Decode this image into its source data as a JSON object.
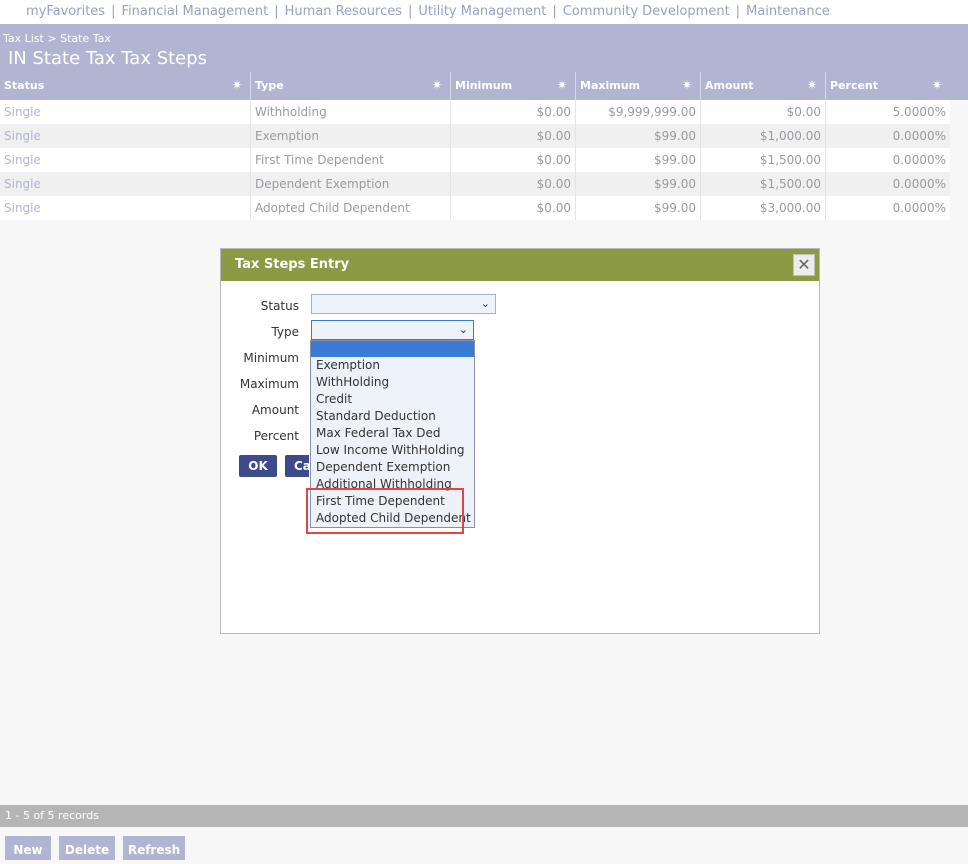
{
  "nav": {
    "items": [
      "myFavorites",
      "Financial Management",
      "Human Resources",
      "Utility Management",
      "Community Development",
      "Maintenance"
    ],
    "separator": "|"
  },
  "header": {
    "breadcrumb": [
      "Tax List",
      ">",
      "State Tax"
    ],
    "title": "IN State Tax Tax Steps"
  },
  "grid": {
    "columns": [
      "Status",
      "Type",
      "Minimum",
      "Maximum",
      "Amount",
      "Percent"
    ],
    "rows": [
      [
        "Single",
        "Withholding",
        "$0.00",
        "$9,999,999.00",
        "$0.00",
        "5.0000%"
      ],
      [
        "Single",
        "Exemption",
        "$0.00",
        "$99.00",
        "$1,000.00",
        "0.0000%"
      ],
      [
        "Single",
        "First Time Dependent",
        "$0.00",
        "$99.00",
        "$1,500.00",
        "0.0000%"
      ],
      [
        "Single",
        "Dependent Exemption",
        "$0.00",
        "$99.00",
        "$1,500.00",
        "0.0000%"
      ],
      [
        "Single",
        "Adopted Child Dependent",
        "$0.00",
        "$99.00",
        "$3,000.00",
        "0.0000%"
      ]
    ],
    "gear_icon": "gear-icon"
  },
  "dialog": {
    "title": "Tax Steps Entry",
    "close_icon": "close-icon",
    "labels": {
      "status": "Status",
      "type": "Type",
      "minimum": "Minimum",
      "maximum": "Maximum",
      "amount": "Amount",
      "percent": "Percent"
    },
    "status_value": "",
    "type_value": "",
    "ok_label": "OK",
    "cancel_label_visible": "Ca",
    "type_options": [
      "",
      "Exemption",
      "WithHolding",
      "Credit",
      "Standard Deduction",
      "Max Federal Tax Ded",
      "Low Income WithHolding",
      "Dependent Exemption",
      "Additional Withholding",
      "First Time Dependent",
      "Adopted Child Dependent"
    ]
  },
  "footer": {
    "records": "1 - 5 of 5 records",
    "new_label": "New",
    "delete_label": "Delete",
    "refresh_label": "Refresh"
  },
  "colors": {
    "header_bg": "#b2b5d2",
    "dialog_title_bg": "#8c9a44",
    "button_bg": "#3d4b8a",
    "highlight": "#e04545",
    "selection": "#3a7bd5"
  }
}
